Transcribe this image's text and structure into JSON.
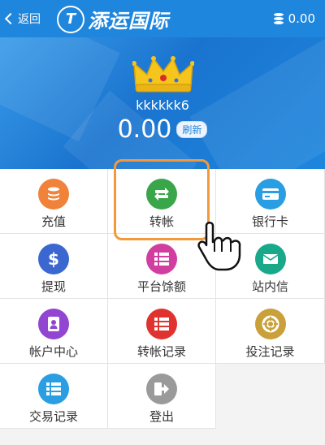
{
  "topbar": {
    "back_label": "返回",
    "brand": "添运国际",
    "logo_letter": "T",
    "balance": "0.00"
  },
  "profile": {
    "username": "kkkkkk6",
    "amount": "0.00",
    "refresh_label": "刷新"
  },
  "menu": [
    {
      "label": "充值",
      "icon": "database-icon",
      "color": "#f0823a"
    },
    {
      "label": "转帐",
      "icon": "transfer-icon",
      "color": "#3aa64a"
    },
    {
      "label": "银行卡",
      "icon": "card-icon",
      "color": "#2a9ee3"
    },
    {
      "label": "提现",
      "icon": "dollar-icon",
      "color": "#3b67d1"
    },
    {
      "label": "平台馀额",
      "icon": "list-icon",
      "color": "#d23ea0"
    },
    {
      "label": "站内信",
      "icon": "mail-icon",
      "color": "#19a889"
    },
    {
      "label": "帐户中心",
      "icon": "contacts-icon",
      "color": "#9145d1"
    },
    {
      "label": "转帐记录",
      "icon": "list-icon",
      "color": "#e0332f"
    },
    {
      "label": "投注记录",
      "icon": "lifebuoy-icon",
      "color": "#c9a03a"
    },
    {
      "label": "交易记录",
      "icon": "list-icon",
      "color": "#2a9ee3"
    },
    {
      "label": "登出",
      "icon": "logout-icon",
      "color": "#9a9a9a"
    }
  ]
}
